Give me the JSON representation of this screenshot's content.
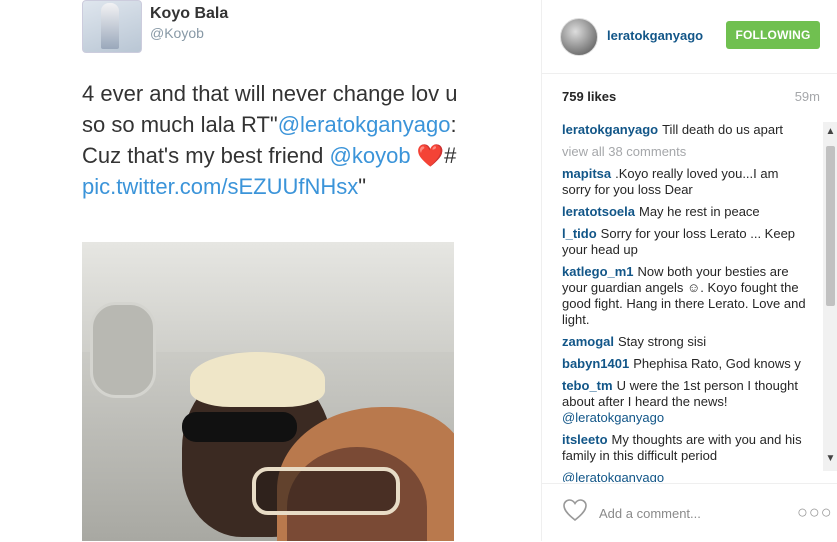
{
  "tweet": {
    "name": "Koyo Bala",
    "handle": "@Koyob",
    "text_1": "4 ever and that will never change lov u so so much lala RT\"",
    "mention_1": "@leratokganyago",
    "text_2": ": Cuz that's my best friend ",
    "mention_2": "@koyob",
    "heart": "❤️",
    "text_3": "#",
    "link": "pic.twitter.com/sEZUUfNHsx",
    "text_4": "\""
  },
  "post": {
    "username": "leratokganyago",
    "follow_label": "FOLLOWING",
    "likes": "759 likes",
    "age": "59m",
    "view_all": "view all 38 comments",
    "add_comment_placeholder": "Add a comment...",
    "comments": [
      {
        "user": "leratokganyago",
        "text": "Till death do us apart"
      },
      {
        "user": "mapitsa",
        "text": ".Koyo really loved you...I am sorry for you loss Dear"
      },
      {
        "user": "leratotsoela",
        "text": "May he rest in peace"
      },
      {
        "user": "l_tido",
        "text": "Sorry for your loss Lerato ... Keep your head up"
      },
      {
        "user": "katlego_m1",
        "text": "Now both your besties are your guardian angels ☺. Koyo fought the good fight. Hang in there Lerato. Love and light."
      },
      {
        "user": "zamogal",
        "text": "Stay strong sisi"
      },
      {
        "user": "babyn1401",
        "text": "Phephisa Rato, God knows y"
      },
      {
        "user": "tebo_tm",
        "text": "U were the 1st person I thought about after I heard the news!",
        "mention": "@leratokganyago"
      },
      {
        "user": "itsleeto",
        "text": "My thoughts are with you and his family in this difficult period"
      },
      {
        "user": "",
        "text": "",
        "mention": "@leratokganyago"
      }
    ]
  },
  "icons": {
    "scroll_up": "▲",
    "scroll_down": "▼",
    "more": "○○○"
  },
  "colors": {
    "follow_button": "#70c050",
    "username_blue": "#125688",
    "twitter_link": "#3b94d9"
  }
}
